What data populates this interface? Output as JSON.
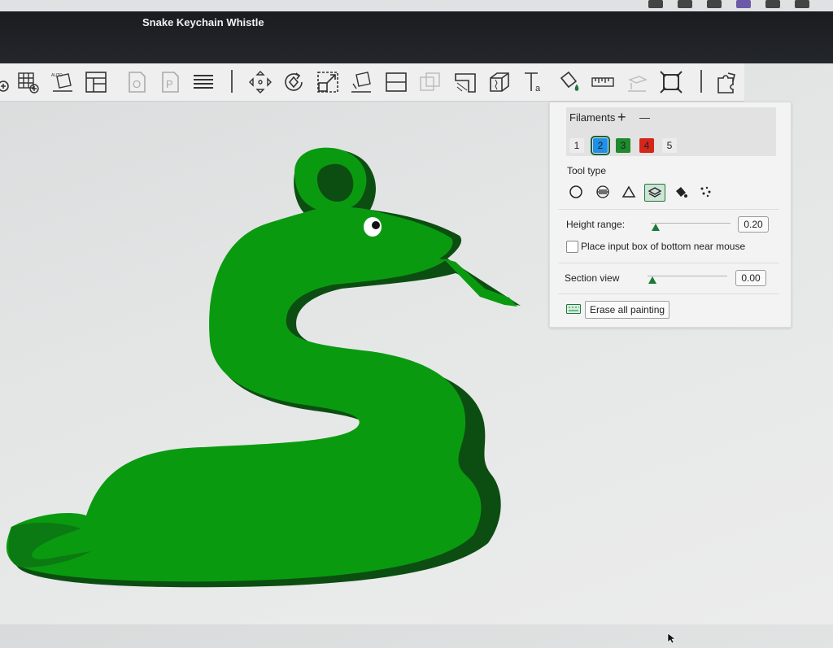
{
  "window": {
    "title": "Snake Keychain Whistle"
  },
  "toolbar": {
    "icons": [
      "add-plate-icon",
      "grid-icon",
      "auto-arrange-icon",
      "layout-icon",
      "object-icon",
      "part-icon",
      "layers-icon",
      "move-icon",
      "rotate-icon",
      "scale-icon",
      "lay-on-face-icon",
      "split-icon",
      "cut-icon",
      "support-paint-icon",
      "seam-icon",
      "measure-cube-icon",
      "text-icon",
      "color-paint-icon",
      "ruler-icon",
      "assembly-icon",
      "fit-icon",
      "puzzle-icon"
    ]
  },
  "panel": {
    "filaments_label": "Filaments",
    "add_label": "+",
    "remove_label": "—",
    "filaments": [
      {
        "label": "1",
        "color": "#ececec"
      },
      {
        "label": "2",
        "color": "#1e90e6"
      },
      {
        "label": "3",
        "color": "#1e8a2e"
      },
      {
        "label": "4",
        "color": "#d4261b"
      },
      {
        "label": "5",
        "color": "#ececec"
      }
    ],
    "selected_filament": "2",
    "tool_type_label": "Tool type",
    "tools": [
      "circle-tool-icon",
      "sphere-tool-icon",
      "triangle-tool-icon",
      "height-range-tool-icon",
      "fill-tool-icon",
      "gap-fill-tool-icon"
    ],
    "selected_tool": "height-range-tool-icon",
    "height_range_label": "Height range:",
    "height_range_value": "0.20",
    "checkbox_label": "Place input box of bottom near mouse",
    "checkbox_checked": false,
    "section_view_label": "Section view",
    "section_view_value": "0.00",
    "erase_label": "Erase all painting"
  },
  "colors": {
    "model": "#0a9a10",
    "model_side": "#0a5a10",
    "accent": "#1b7a38"
  }
}
